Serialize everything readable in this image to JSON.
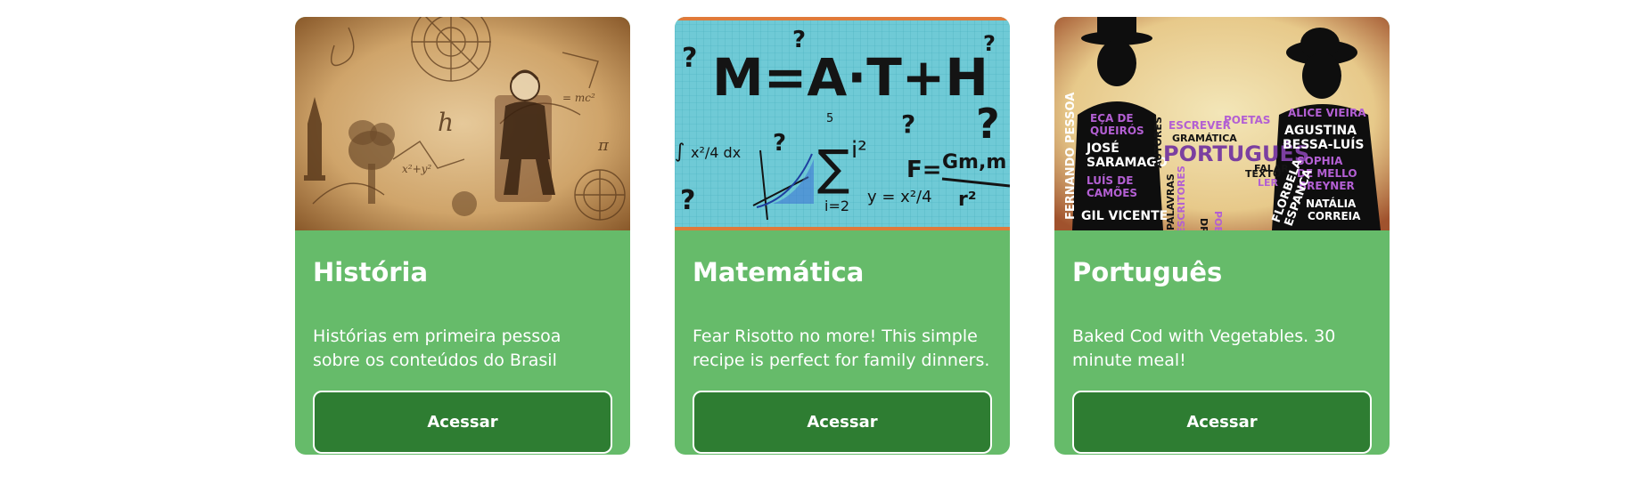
{
  "courses": [
    {
      "title": "História",
      "description": "Histórias em primeira pessoa sobre os conteúdos do Brasil",
      "button_label": "Acessar",
      "image": "history-collage"
    },
    {
      "title": "Matemática",
      "description": "Fear Risotto no more! This simple recipe is perfect for family dinners.",
      "button_label": "Acessar",
      "image": "math-chalkboard",
      "image_text": {
        "headline": "M=A·T+H",
        "sigma_top": "5",
        "sigma_exp": "i²",
        "sigma_bottom": "i=2",
        "formula_y": "y = x²/4",
        "formula_f": "F = Gm₁m₂ / r²",
        "integral": "∫ x²/4 dx"
      }
    },
    {
      "title": "Português",
      "description": "Baked Cod with Vegetables. 30 minute meal!",
      "button_label": "Acessar",
      "image": "portuguese-authors-poster",
      "image_text": {
        "left_words": [
          "ECA DE QUEIRÓS",
          "JOSÉ SARAMAGO",
          "LUÍS DE CAMÕES",
          "GIL VICENTE",
          "FERNANDO PESSOA"
        ],
        "center_words": [
          "ESCREVER",
          "POETAS",
          "AUTORES",
          "GRAMÁTICA",
          "PORTUGUÊS",
          "TEXTO",
          "FALAR",
          "LER",
          "DRAMA",
          "POESIA",
          "ESCRITORES",
          "PALAVRAS",
          "TURCOS"
        ],
        "right_words": [
          "ALICE VIEIRA",
          "AGUSTINA BESSA-LUÍS",
          "SOPHIA DE MELLO BREYNER",
          "FLORBELA ESPANCA",
          "NATÁLIA CORREIA"
        ]
      }
    }
  ],
  "colors": {
    "card_bg": "#66bb6a",
    "button_bg": "#2e7d32",
    "text": "#ffffff"
  }
}
